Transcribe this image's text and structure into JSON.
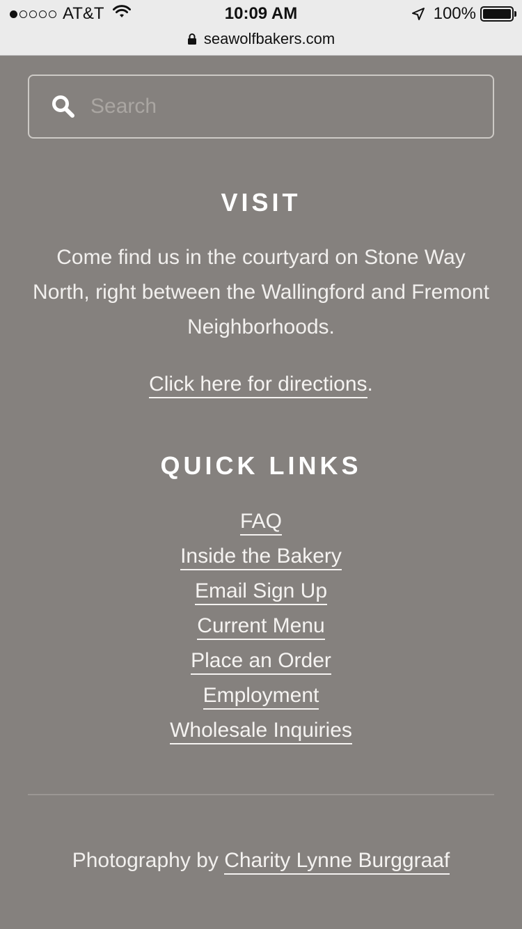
{
  "status_bar": {
    "carrier": "AT&T",
    "time": "10:09 AM",
    "battery": "100%"
  },
  "url_bar": {
    "domain": "seawolfbakers.com"
  },
  "search": {
    "placeholder": "Search",
    "value": ""
  },
  "visit": {
    "title": "VISIT",
    "text": "Come find us in the courtyard on Stone Way North, right between the Wallingford and Fremont Neighborhoods.",
    "directions_link": "Click here for directions",
    "directions_suffix": "."
  },
  "quick_links": {
    "title": "QUICK LINKS",
    "items": [
      {
        "label": "FAQ"
      },
      {
        "label": "Inside the Bakery"
      },
      {
        "label": "Email Sign Up"
      },
      {
        "label": "Current Menu"
      },
      {
        "label": "Place an Order"
      },
      {
        "label": "Employment"
      },
      {
        "label": "Wholesale Inquiries"
      }
    ]
  },
  "footer": {
    "credit_prefix": "Photography by ",
    "credit_name": "Charity Lynne Burggraaf"
  },
  "icons": {
    "signal": "signal-dots-icon",
    "wifi": "wifi-icon",
    "location": "location-arrow-icon",
    "battery": "battery-icon",
    "lock": "lock-icon",
    "search": "search-icon"
  },
  "colors": {
    "background": "#85817e",
    "text": "#ffffff",
    "status_bar": "#ebebeb"
  }
}
